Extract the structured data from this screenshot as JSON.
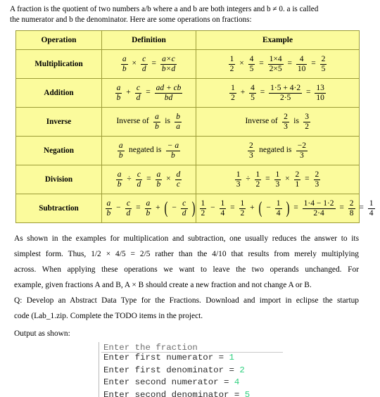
{
  "intro": {
    "line1": "A fraction is the quotient of two numbers a/b where a and b are both integers and b ≠ 0. a is called",
    "line2": "the numerator and b the denominator. Here are some operations on fractions:"
  },
  "table": {
    "headers": [
      "Operation",
      "Definition",
      "Example"
    ],
    "rows": [
      {
        "operation": "Multiplication",
        "definition": {
          "a": "a",
          "b": "b",
          "op1": "×",
          "c": "c",
          "d": "d",
          "eq": "=",
          "rnum": "a×c",
          "rden": "b×d"
        },
        "example": {
          "n1": "1",
          "d1": "2",
          "op1": "×",
          "n2": "4",
          "d2": "5",
          "eq1": "=",
          "n3": "1×4",
          "d3": "2×5",
          "eq2": "=",
          "n4": "4",
          "d4": "10",
          "eq3": "=",
          "n5": "2",
          "d5": "5"
        }
      },
      {
        "operation": "Addition",
        "definition": {
          "a": "a",
          "b": "b",
          "op1": "+",
          "c": "c",
          "d": "d",
          "eq": "=",
          "rnum": "ad + cb",
          "rden": "bd"
        },
        "example": {
          "n1": "1",
          "d1": "2",
          "op1": "+",
          "n2": "4",
          "d2": "5",
          "eq1": "=",
          "n3": "1·5 + 4·2",
          "d3": "2·5",
          "eq2": "=",
          "n4": "13",
          "d4": "10"
        }
      },
      {
        "operation": "Inverse",
        "definition": {
          "pre": "Inverse of",
          "a": "a",
          "b": "b",
          "mid": "is",
          "c": "b",
          "d": "a"
        },
        "example": {
          "pre": "Inverse of",
          "n1": "2",
          "d1": "3",
          "mid": "is",
          "n2": "3",
          "d2": "2"
        }
      },
      {
        "operation": "Negation",
        "definition": {
          "a": "a",
          "b": "b",
          "mid": "negated is",
          "rnum": "− a",
          "rden": "b"
        },
        "example": {
          "n1": "2",
          "d1": "3",
          "mid": "negated is",
          "n2": "−2",
          "d2": "3"
        }
      },
      {
        "operation": "Division",
        "definition": {
          "a": "a",
          "b": "b",
          "op1": "÷",
          "c": "c",
          "d": "d",
          "eq": "=",
          "n3": "a",
          "d3": "b",
          "op2": "×",
          "n4": "d",
          "d4": "c"
        },
        "example": {
          "n1": "1",
          "d1": "3",
          "op1": "÷",
          "n2": "1",
          "d2": "2",
          "eq1": "=",
          "n3": "1",
          "d3": "3",
          "op2": "×",
          "n4": "2",
          "d4": "1",
          "eq2": "=",
          "n5": "2",
          "d5": "3"
        }
      },
      {
        "operation": "Subtraction",
        "definition": {
          "a": "a",
          "b": "b",
          "op1": "−",
          "c": "c",
          "d": "d",
          "eq": "=",
          "n3": "a",
          "d3": "b",
          "op2": "+",
          "neg": "−",
          "n4": "c",
          "d4": "d"
        },
        "example": {
          "n1": "1",
          "d1": "2",
          "op1": "−",
          "n2": "1",
          "d2": "4",
          "eq1": "=",
          "n3": "1",
          "d3": "2",
          "op2": "+",
          "neg": "−",
          "n4": "1",
          "d4": "4",
          "eq2": "=",
          "n5": "1·4 − 1·2",
          "d5": "2·4",
          "eq3": "=",
          "n6": "2",
          "d6": "8",
          "eq4": "=",
          "n7": "1",
          "d7": "4"
        }
      }
    ]
  },
  "body": {
    "line1": "As shown in the examples for multiplication and subtraction, one usually reduces the answer to its",
    "line2": "simplest form. Thus, 1/2 × 4/5 = 2/5 rather than the 4/10 that results from merely multiplying",
    "line3": "across. When applying these operations we want to leave the two operands unchanged. For",
    "line4": "example, given fractions A and B, A × B should create a new fraction and not change A or B.",
    "line5": "Q: Develop an Abstract Data Type for the Fractions. Download and import in eclipse the startup",
    "line6": "code (Lab_1.zip. Complete the TODO items in the project.",
    "output_label": "Output as shown:"
  },
  "console": {
    "clipped_row": "Enter the fraction",
    "lines": [
      {
        "label": "Enter first numerator = ",
        "value": "1"
      },
      {
        "label": "Enter first denominator = ",
        "value": "2"
      },
      {
        "label": "Enter second numerator = ",
        "value": "4"
      },
      {
        "label": "Enter second denominator = ",
        "value": "5"
      }
    ]
  },
  "colors": {
    "table_background": "#fbfb9c",
    "table_border": "#9c9c37",
    "console_value": "#2fd07f",
    "console_text": "#2b2b2b",
    "console_border": "#b9b9b9"
  }
}
